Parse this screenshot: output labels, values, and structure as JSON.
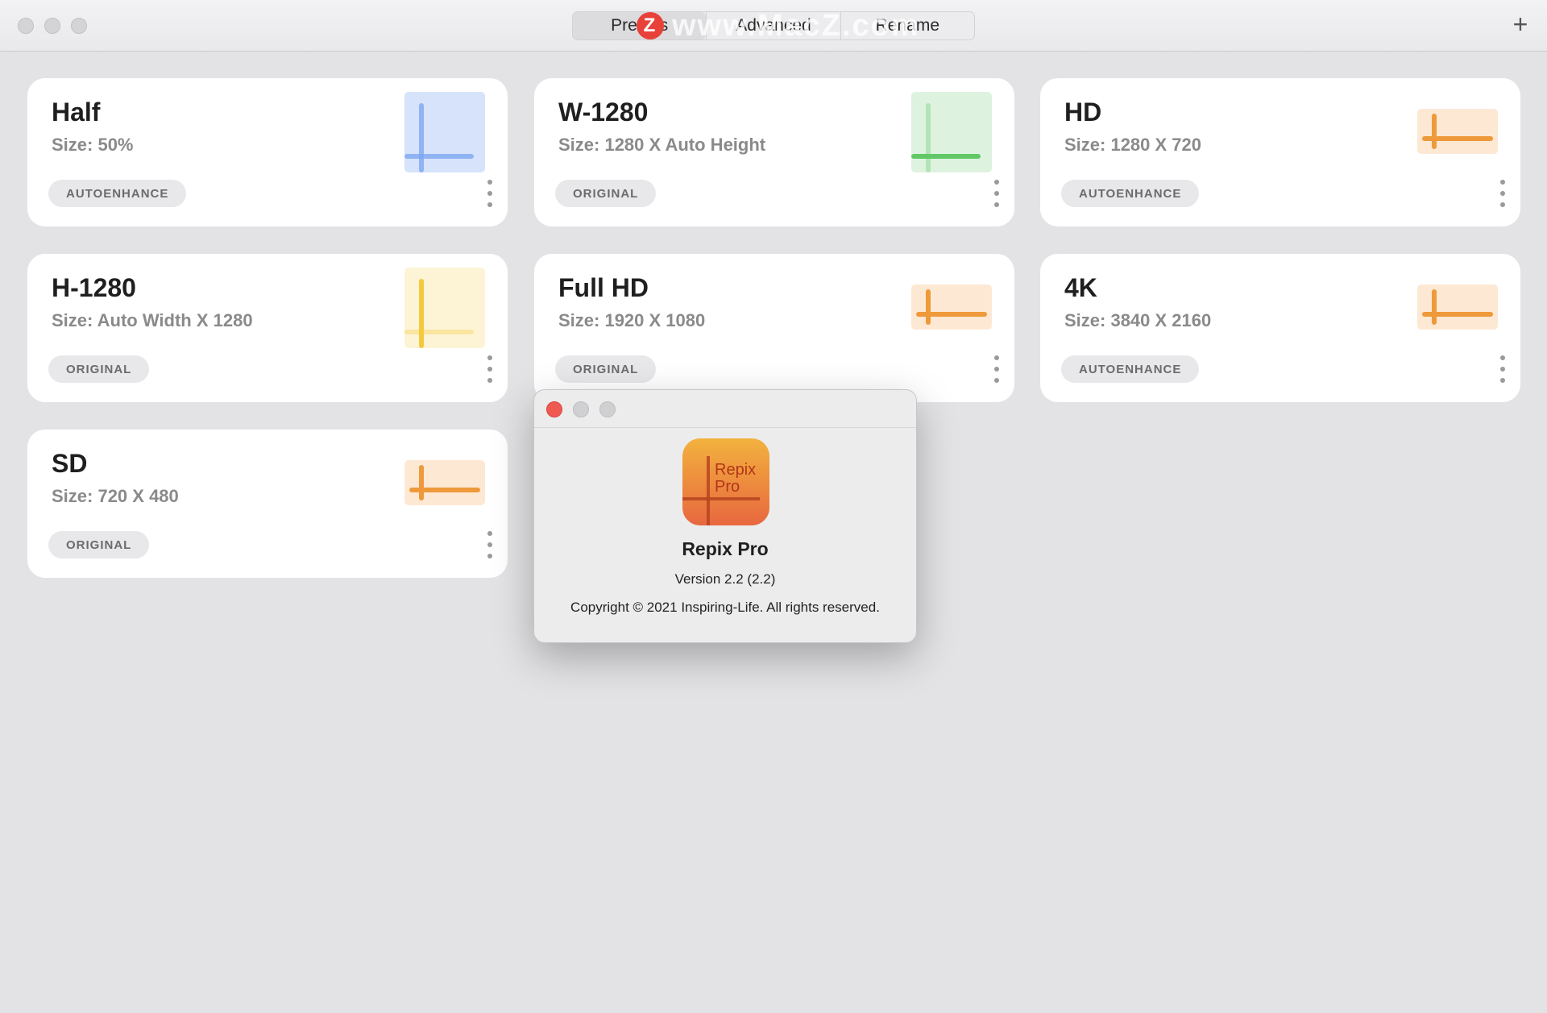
{
  "toolbar": {
    "segments": [
      "Presets",
      "Advanced",
      "Rename"
    ],
    "add_label": "+"
  },
  "watermark": {
    "logo_letter": "Z",
    "text": "www.MacZ.com"
  },
  "presets": [
    {
      "title": "Half",
      "size": "Size: 50%",
      "badge": "AUTOENHANCE",
      "accent": "#7ea6f2",
      "tint": "#d6e3fb",
      "icon": "crop-width-height-icon"
    },
    {
      "title": "W-1280",
      "size": "Size: 1280 X Auto Height",
      "badge": "ORIGINAL",
      "accent": "#62c866",
      "tint": "#def3df",
      "icon": "crop-width-icon"
    },
    {
      "title": "HD",
      "size": "Size: 1280 X 720",
      "badge": "AUTOENHANCE",
      "accent": "#ee9a3a",
      "tint": "#fde8d4",
      "icon": "crop-fixed-icon"
    },
    {
      "title": "H-1280",
      "size": "Size: Auto Width X 1280",
      "badge": "ORIGINAL",
      "accent": "#f4c93c",
      "tint": "#fdf4d6",
      "icon": "crop-height-icon"
    },
    {
      "title": "Full HD",
      "size": "Size: 1920 X 1080",
      "badge": "ORIGINAL",
      "accent": "#ee9a3a",
      "tint": "#fde8d4",
      "icon": "crop-fixed-icon"
    },
    {
      "title": "4K",
      "size": "Size: 3840 X 2160",
      "badge": "AUTOENHANCE",
      "accent": "#ee9a3a",
      "tint": "#fde8d4",
      "icon": "crop-fixed-icon"
    },
    {
      "title": "SD",
      "size": "Size: 720 X 480",
      "badge": "ORIGINAL",
      "accent": "#ee9a3a",
      "tint": "#fde8d4",
      "icon": "crop-fixed-icon"
    }
  ],
  "about": {
    "icon_line1": "Repix",
    "icon_line2": "Pro",
    "app_name": "Repix Pro",
    "version": "Version 2.2 (2.2)",
    "copyright": "Copyright © 2021 Inspiring-Life. All rights reserved."
  },
  "colors": {
    "close": "#ee5a52",
    "inactive": "#d0d0d2"
  }
}
